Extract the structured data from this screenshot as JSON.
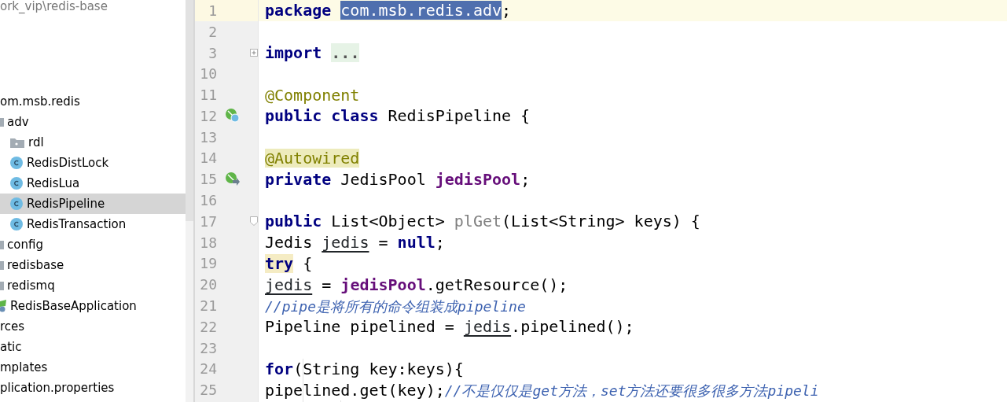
{
  "project_path": "ork_vip\\redis-base",
  "tree": [
    {
      "label": "om.msb.redis",
      "selected": false,
      "children": [
        {
          "label": "adv",
          "kind": "folder",
          "selected": false,
          "children": [
            {
              "label": "rdl",
              "kind": "folder",
              "selected": false
            },
            {
              "label": "RedisDistLock",
              "kind": "class",
              "selected": false
            },
            {
              "label": "RedisLua",
              "kind": "class",
              "selected": false
            },
            {
              "label": "RedisPipeline",
              "kind": "class",
              "selected": true
            },
            {
              "label": "RedisTransaction",
              "kind": "class",
              "selected": false
            }
          ]
        },
        {
          "label": "config",
          "kind": "folder",
          "selected": false
        },
        {
          "label": "redisbase",
          "kind": "folder",
          "selected": false
        },
        {
          "label": "redismq",
          "kind": "folder",
          "selected": false
        },
        {
          "label": "RedisBaseApplication",
          "kind": "app",
          "selected": false
        }
      ]
    },
    {
      "label": "rces",
      "selected": false
    },
    {
      "label": "atic",
      "selected": false
    },
    {
      "label": "mplates",
      "selected": false
    },
    {
      "label": "plication.properties",
      "selected": false
    }
  ],
  "editor": {
    "lines": [
      {
        "number": "1",
        "current": true,
        "tokens": [
          {
            "t": "package ",
            "kind": "kw"
          },
          {
            "t": "com.msb.redis.adv",
            "kind": "sel"
          },
          {
            "t": ";",
            "kind": "plain"
          }
        ]
      },
      {
        "number": "2",
        "current": false
      },
      {
        "number": "3",
        "current": false,
        "markers": [
          {
            "kind": "fold-collapsed"
          }
        ],
        "tokens": [
          {
            "t": "import ",
            "kind": "kw"
          },
          {
            "t": "...",
            "kind": "folded"
          }
        ]
      },
      {
        "number": "10",
        "current": false
      },
      {
        "number": "11",
        "current": false,
        "tokens": [
          {
            "t": "@Component",
            "kind": "ann"
          }
        ]
      },
      {
        "number": "12",
        "current": false,
        "markers": [
          {
            "kind": "class"
          }
        ],
        "tokens": [
          {
            "t": "public class",
            "kind": "kw"
          },
          {
            "t": " RedisPipeline {",
            "kind": "plain"
          }
        ]
      },
      {
        "number": "13",
        "current": false
      },
      {
        "number": "14",
        "current": false,
        "tokens": [
          {
            "t": "    @Autowired",
            "kind": "ann-hl"
          }
        ]
      },
      {
        "number": "15",
        "current": false,
        "markers": [
          {
            "kind": "field"
          }
        ],
        "tokens": [
          {
            "t": "    private",
            "kind": "kw"
          },
          {
            "t": " JedisPool ",
            "kind": "plain"
          },
          {
            "t": "jedisPool",
            "kind": "field"
          },
          {
            "t": ";",
            "kind": "plain"
          }
        ]
      },
      {
        "number": "16",
        "current": false
      },
      {
        "number": "17",
        "current": false,
        "markers": [
          {
            "kind": "fold-open"
          }
        ],
        "tokens": [
          {
            "t": "    public",
            "kind": "kw"
          },
          {
            "t": " List<Object> ",
            "kind": "plain"
          },
          {
            "t": "plGet",
            "kind": "unused"
          },
          {
            "t": "(List<String> keys) {",
            "kind": "plain"
          }
        ]
      },
      {
        "number": "18",
        "current": false,
        "tokens": [
          {
            "t": "        Jedis ",
            "kind": "plain"
          },
          {
            "t": "jedis",
            "kind": "var"
          },
          {
            "t": " = ",
            "kind": "plain"
          },
          {
            "t": "null",
            "kind": "kw"
          },
          {
            "t": ";",
            "kind": "plain"
          }
        ]
      },
      {
        "number": "19",
        "current": false,
        "tokens": [
          {
            "t": "        try",
            "kind": "kw-hl"
          },
          {
            "t": " {",
            "kind": "plain"
          }
        ]
      },
      {
        "number": "20",
        "current": false,
        "tokens": [
          {
            "t": "            jedis",
            "kind": "var"
          },
          {
            "t": " = ",
            "kind": "plain"
          },
          {
            "t": "jedisPool",
            "kind": "field"
          },
          {
            "t": ".getResource();",
            "kind": "plain"
          }
        ]
      },
      {
        "number": "21",
        "current": false,
        "tokens": [
          {
            "t": "            //pipe是将所有的命令组装成pipeline",
            "kind": "comment"
          }
        ]
      },
      {
        "number": "22",
        "current": false,
        "tokens": [
          {
            "t": "            Pipeline pipelined = ",
            "kind": "plain"
          },
          {
            "t": "jedis",
            "kind": "var"
          },
          {
            "t": ".pipelined();",
            "kind": "plain"
          }
        ]
      },
      {
        "number": "23",
        "current": false
      },
      {
        "number": "24",
        "current": false,
        "tokens": [
          {
            "t": "            for",
            "kind": "kw"
          },
          {
            "t": "(String key:keys){",
            "kind": "plain"
          }
        ]
      },
      {
        "number": "25",
        "current": false,
        "tokens": [
          {
            "t": "                pipelined.get(key);",
            "kind": "plain"
          },
          {
            "t": "//不是仅仅是get方法，set方法还要很多很多方法pipeli",
            "kind": "comment"
          }
        ]
      }
    ]
  }
}
